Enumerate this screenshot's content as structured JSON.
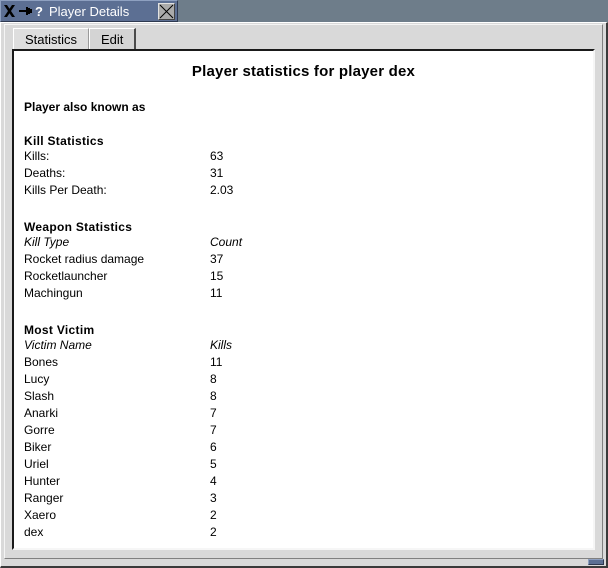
{
  "window": {
    "title": "Player Details",
    "icons": {
      "x11": "x11-logo-icon",
      "pin": "window-menu-pin-icon",
      "help": "?",
      "close": "close-icon"
    }
  },
  "tabs": [
    {
      "label": "Statistics",
      "active": true
    },
    {
      "label": "Edit",
      "active": false
    }
  ],
  "document": {
    "title": "Player statistics for player dex",
    "aka_label": "Player also known as",
    "aka_value": "",
    "sections": {
      "kill_statistics": {
        "heading": "Kill Statistics",
        "rows": [
          {
            "label": "Kills:",
            "value": "63"
          },
          {
            "label": "Deaths:",
            "value": "31"
          },
          {
            "label": "Kills Per Death:",
            "value": "2.03"
          }
        ]
      },
      "weapon_statistics": {
        "heading": "Weapon Statistics",
        "col_label": "Kill Type",
        "col_value": "Count",
        "rows": [
          {
            "label": "Rocket radius damage",
            "value": "37"
          },
          {
            "label": "Rocketlauncher",
            "value": "15"
          },
          {
            "label": "Machingun",
            "value": "11"
          }
        ]
      },
      "most_victim": {
        "heading": "Most Victim",
        "col_label": "Victim Name",
        "col_value": "Kills",
        "rows": [
          {
            "label": "Bones",
            "value": "11"
          },
          {
            "label": "Lucy",
            "value": "8"
          },
          {
            "label": "Slash",
            "value": "8"
          },
          {
            "label": "Anarki",
            "value": "7"
          },
          {
            "label": "Gorre",
            "value": "7"
          },
          {
            "label": "Biker",
            "value": "6"
          },
          {
            "label": "Uriel",
            "value": "5"
          },
          {
            "label": "Hunter",
            "value": "4"
          },
          {
            "label": "Ranger",
            "value": "3"
          },
          {
            "label": "Xaero",
            "value": "2"
          },
          {
            "label": "dex",
            "value": "2"
          }
        ]
      }
    }
  },
  "colors": {
    "desktop": "#6e7d8a",
    "titlebar_active": "#5c6f93",
    "face": "#d9d9d9",
    "content_bg": "#ffffff",
    "text": "#000000"
  }
}
